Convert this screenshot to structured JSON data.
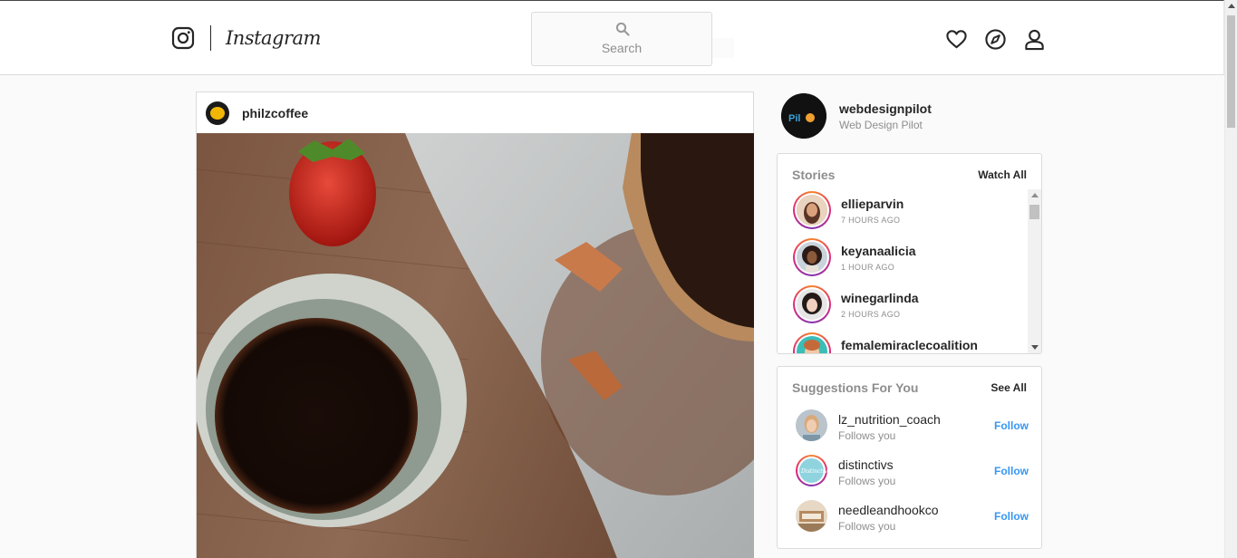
{
  "header": {
    "logo_word": "Instagram",
    "search_placeholder": "Search"
  },
  "icons": {
    "logo": "instagram-camera-icon",
    "search": "search-icon",
    "activity": "heart-icon",
    "explore": "compass-icon",
    "profile": "user-icon"
  },
  "post": {
    "username": "philzcoffee"
  },
  "profile": {
    "username": "webdesignpilot",
    "full_name": "Web Design Pilot"
  },
  "stories": {
    "title": "Stories",
    "action": "Watch All",
    "items": [
      {
        "username": "ellieparvin",
        "time": "7 HOURS AGO"
      },
      {
        "username": "keyanaalicia",
        "time": "1 HOUR AGO"
      },
      {
        "username": "winegarlinda",
        "time": "2 HOURS AGO"
      },
      {
        "username": "femalemiraclecoalition",
        "time": ""
      }
    ]
  },
  "suggestions": {
    "title": "Suggestions For You",
    "action": "See All",
    "items": [
      {
        "username": "lz_nutrition_coach",
        "subtitle": "Follows you",
        "button": "Follow"
      },
      {
        "username": "distinctivs",
        "subtitle": "Follows you",
        "button": "Follow"
      },
      {
        "username": "needleandhookco",
        "subtitle": "Follows you",
        "button": "Follow"
      }
    ]
  },
  "colors": {
    "accent": "#3897f0",
    "text": "#262626",
    "muted": "#8e8e8e",
    "border": "#dbdbdb",
    "background": "#fafafa"
  }
}
